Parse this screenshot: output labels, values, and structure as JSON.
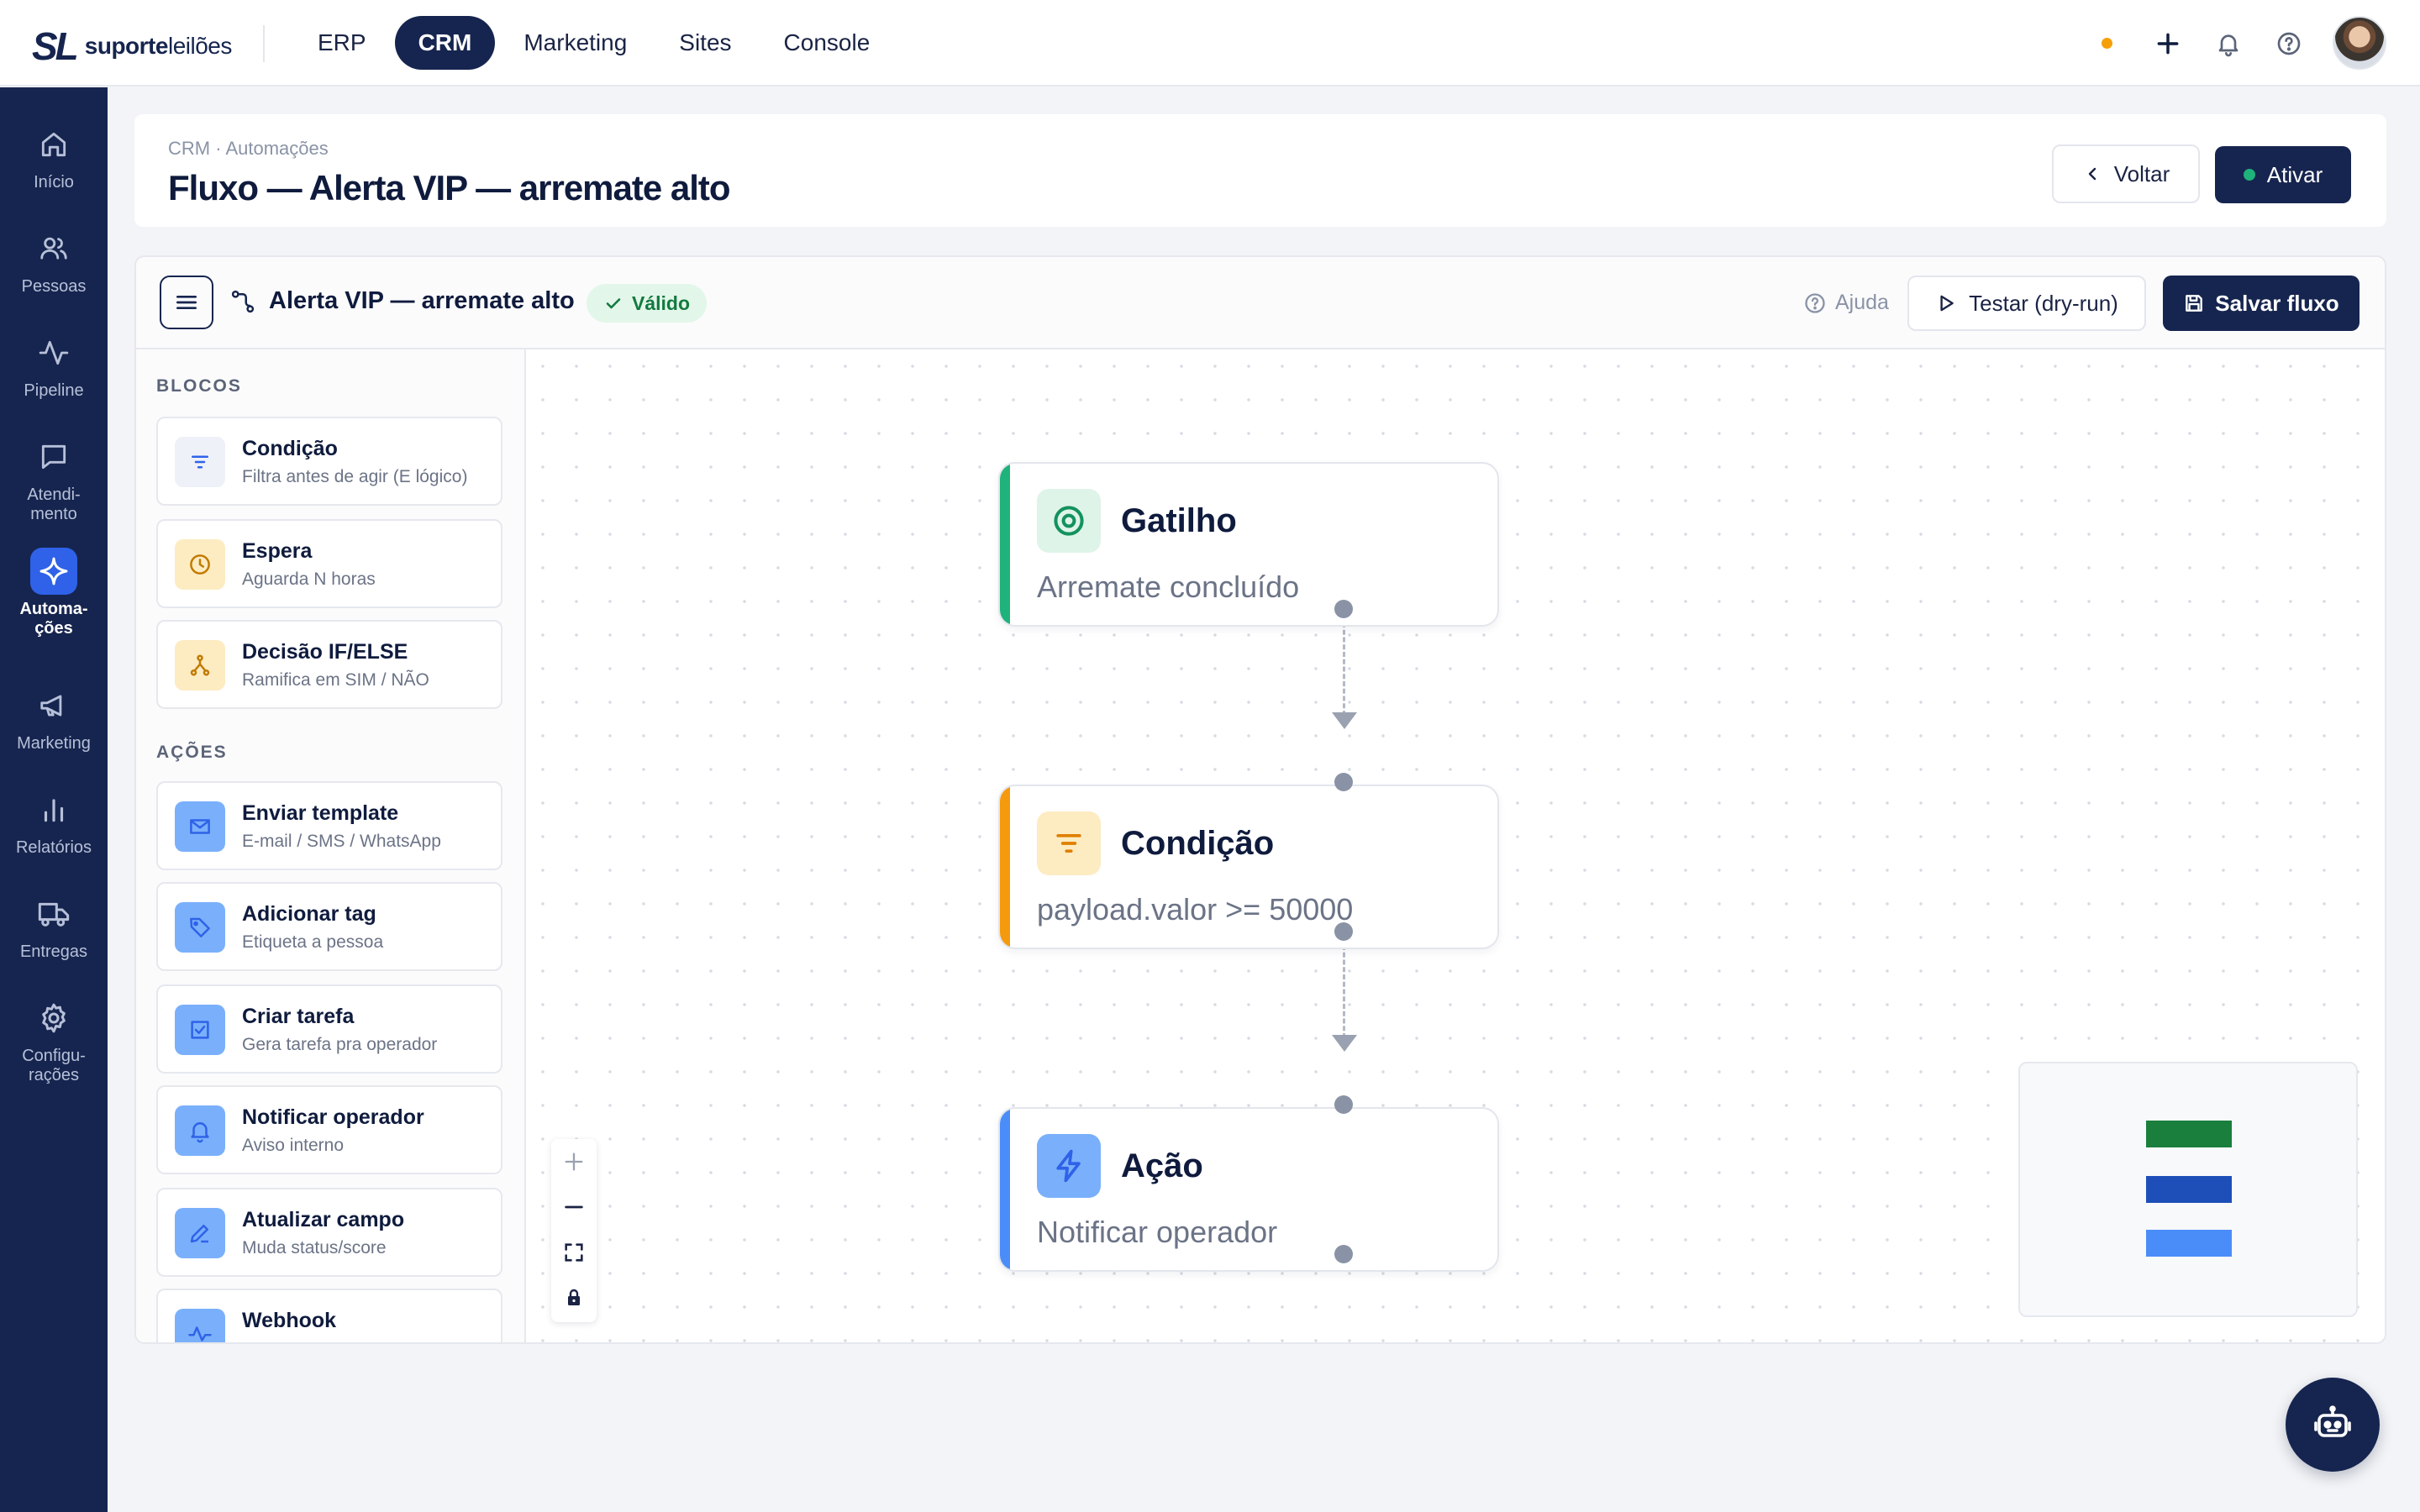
{
  "brand": {
    "mark": "SL",
    "name_bold": "suporte",
    "name_rest": "leilões"
  },
  "topnav": [
    {
      "label": "ERP",
      "active": false
    },
    {
      "label": "CRM",
      "active": true
    },
    {
      "label": "Marketing",
      "active": false
    },
    {
      "label": "Sites",
      "active": false
    },
    {
      "label": "Console",
      "active": false
    }
  ],
  "topright": {
    "status_dot_color": "#f5a00a",
    "icons": [
      "plus-icon",
      "bell-icon",
      "help-circle-icon"
    ],
    "avatar": "user-avatar"
  },
  "sidebar": {
    "items": [
      {
        "label": "Início",
        "icon": "home-icon"
      },
      {
        "label": "Pessoas",
        "icon": "users-icon"
      },
      {
        "label": "Pipeline",
        "icon": "activity-icon"
      },
      {
        "label": "Atendi-\nmento",
        "icon": "chat-icon"
      },
      {
        "label": "Automa-\nções",
        "icon": "sparkle-icon",
        "active": true
      },
      {
        "label": "Marketing",
        "icon": "megaphone-icon"
      },
      {
        "label": "Relatórios",
        "icon": "bar-chart-icon"
      },
      {
        "label": "Entregas",
        "icon": "truck-icon"
      },
      {
        "label": "Configu-\nrações",
        "icon": "gear-icon"
      }
    ],
    "expand_icon": "chevrons-right-icon"
  },
  "header": {
    "breadcrumb": "CRM · Automações",
    "title": "Fluxo — Alerta VIP — arremate alto",
    "back_label": "Voltar",
    "activate_label": "Ativar"
  },
  "toolbar": {
    "flow_name": "Alerta VIP — arremate alto",
    "status": "Válido",
    "help_label": "Ajuda",
    "test_label": "Testar (dry-run)",
    "save_label": "Salvar fluxo"
  },
  "palette": {
    "blocks_heading": "BLOCOS",
    "blocks": [
      {
        "title": "Condição",
        "subtitle": "Filtra antes de agir (E lógico)",
        "icon": "filter-icon"
      },
      {
        "title": "Espera",
        "subtitle": "Aguarda N horas",
        "icon": "clock-icon"
      },
      {
        "title": "Decisão IF/ELSE",
        "subtitle": "Ramifica em SIM / NÃO",
        "icon": "branch-icon"
      }
    ],
    "actions_heading": "AÇÕES",
    "actions": [
      {
        "title": "Enviar template",
        "subtitle": "E-mail / SMS / WhatsApp",
        "icon": "mail-icon"
      },
      {
        "title": "Adicionar tag",
        "subtitle": "Etiqueta a pessoa",
        "icon": "tag-icon"
      },
      {
        "title": "Criar tarefa",
        "subtitle": "Gera tarefa pra operador",
        "icon": "checkbox-icon"
      },
      {
        "title": "Notificar operador",
        "subtitle": "Aviso interno",
        "icon": "bell-icon"
      },
      {
        "title": "Atualizar campo",
        "subtitle": "Muda status/score",
        "icon": "pencil-icon"
      },
      {
        "title": "Webhook",
        "subtitle": "",
        "icon": "webhook-icon"
      }
    ]
  },
  "flow": {
    "nodes": [
      {
        "title": "Gatilho",
        "subtitle": "Arremate concluído",
        "icon": "target-icon",
        "color": "#1fb27a"
      },
      {
        "title": "Condição",
        "subtitle": "payload.valor >= 50000",
        "icon": "filter-icon",
        "color": "#f59a0c"
      },
      {
        "title": "Ação",
        "subtitle": "Notificar operador",
        "icon": "lightning-icon",
        "color": "#4a8df8"
      }
    ]
  },
  "canvas_controls": [
    "zoom-in-icon",
    "zoom-out-icon",
    "fit-view-icon",
    "lock-icon"
  ],
  "minimap": {
    "node_colors": [
      "#1a7f3c",
      "#1e4fb8",
      "#4a8df8"
    ]
  },
  "assistant": {
    "icon": "robot-icon"
  }
}
